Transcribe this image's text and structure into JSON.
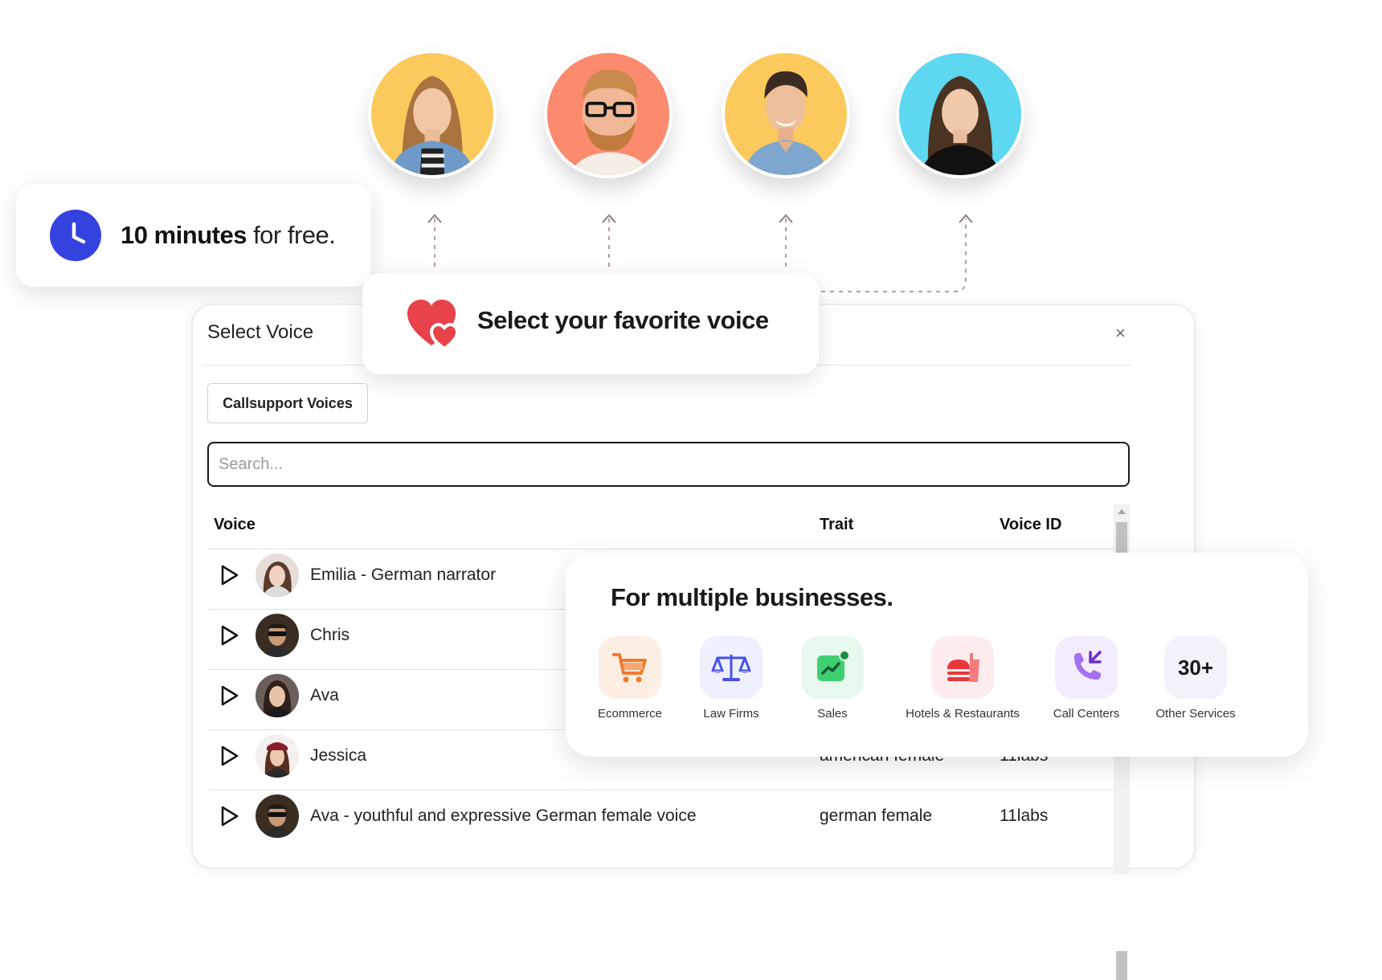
{
  "free_card": {
    "bold": "10 minutes",
    "rest": " for free."
  },
  "favorite_card": {
    "title": "Select your favorite voice"
  },
  "modal": {
    "title": "Select Voice",
    "close": "×",
    "tab_label": "Callsupport Voices",
    "search_placeholder": "Search...",
    "columns": {
      "voice": "Voice",
      "trait": "Trait",
      "voice_id": "Voice ID"
    },
    "rows": [
      {
        "name": "Emilia - German narrator",
        "trait": "",
        "id": ""
      },
      {
        "name": "Chris",
        "trait": "",
        "id": ""
      },
      {
        "name": "Ava",
        "trait": "",
        "id": ""
      },
      {
        "name": "Jessica",
        "trait": "american  female",
        "id": "11labs"
      },
      {
        "name": "Ava - youthful and expressive German female voice",
        "trait": "german  female",
        "id": "11labs"
      }
    ]
  },
  "businesses": {
    "title": "For multiple businesses.",
    "items": [
      {
        "label": "Ecommerce",
        "icon": "cart-icon",
        "color": "#fdeee4"
      },
      {
        "label": "Law Firms",
        "icon": "scales-icon",
        "color": "#eef0fd"
      },
      {
        "label": "Sales",
        "icon": "trend-up-icon",
        "color": "#e7f8ec"
      },
      {
        "label": "Hotels & Restaurants",
        "icon": "food-icon",
        "color": "#fdeced"
      },
      {
        "label": "Call Centers",
        "icon": "phone-icon",
        "color": "#f3ecfd"
      },
      {
        "label": "Other Services",
        "icon": "more-icon",
        "text": "30+",
        "color": "#f4f1fb"
      }
    ]
  },
  "colors": {
    "accent": "#3442e0",
    "heart": "#e8424a",
    "connector": "#b89aa8"
  }
}
